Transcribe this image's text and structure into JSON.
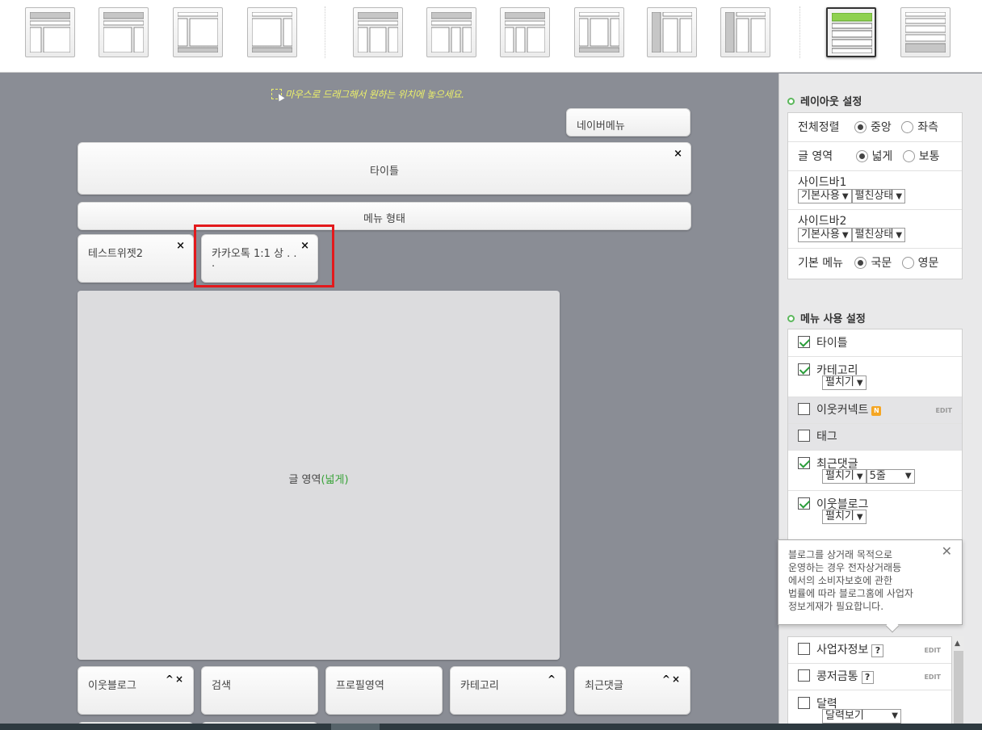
{
  "layout_thumbnails": {
    "items": [
      {
        "name": "layout-1"
      },
      {
        "name": "layout-2"
      },
      {
        "name": "layout-3"
      },
      {
        "name": "layout-4"
      },
      {
        "name": "layout-5"
      },
      {
        "name": "layout-6"
      },
      {
        "name": "layout-7"
      },
      {
        "name": "layout-8"
      },
      {
        "name": "layout-9"
      },
      {
        "name": "layout-10"
      },
      {
        "name": "layout-11",
        "selected": true
      },
      {
        "name": "layout-12"
      }
    ]
  },
  "canvas": {
    "hint": "마우스로 드래그해서 원하는 위치에 놓으세요.",
    "naver_menu": "네이버메뉴",
    "title_widget": "타이틀",
    "menu_widget": "메뉴 형태",
    "widget_test": "테스트위젯2",
    "widget_kakao": "카카오톡 1:1 상 . .",
    "widget_kakao_line2": ".",
    "content_area": "글 영역",
    "content_area_mode": "(넓게)",
    "bottom_widgets": [
      "이웃블로그",
      "검색",
      "프로필영역",
      "카테고리",
      "최근댓글"
    ],
    "close_glyph": "×",
    "ctrl_up_close": "^×",
    "ctrl_up": "^"
  },
  "layout_settings": {
    "title": "레이아웃 설정",
    "align_label": "전체정렬",
    "align_options": [
      "중앙",
      "좌측"
    ],
    "content_label": "글 영역",
    "content_options": [
      "넓게",
      "보통"
    ],
    "sidebar1_label": "사이드바1",
    "sidebar1_select1": "기본사용",
    "sidebar1_select2": "펼친상태",
    "sidebar2_label": "사이드바2",
    "sidebar2_select1": "기본사용",
    "sidebar2_select2": "펼친상태",
    "menu_label": "기본 메뉴",
    "menu_options": [
      "국문",
      "영문"
    ]
  },
  "menu_settings": {
    "title": "메뉴 사용 설정",
    "items": {
      "title": "타이틀",
      "category": "카테고리",
      "category_select": "펼치기",
      "neighbor_connect": "이웃커넥트",
      "neighbor_badge": "N",
      "tag": "태그",
      "recent_comments": "최근댓글",
      "recent_select1": "펼치기",
      "recent_select2": "5줄",
      "neighbor_blog": "이웃블로그",
      "neighbor_select": "펼치기"
    },
    "edit_label": "EDIT"
  },
  "lower_settings": {
    "business_info": "사업자정보",
    "donation": "콩저금통",
    "calendar": "달력",
    "calendar_select": "달력보기"
  },
  "tooltip": {
    "text_lines": [
      "블로그를 상거래 목적으로",
      "운영하는 경우 전자상거래등",
      "에서의 소비자보호에 관한",
      "법률에 따라 블로그홈에 사업자",
      "정보게재가 필요합니다."
    ]
  }
}
